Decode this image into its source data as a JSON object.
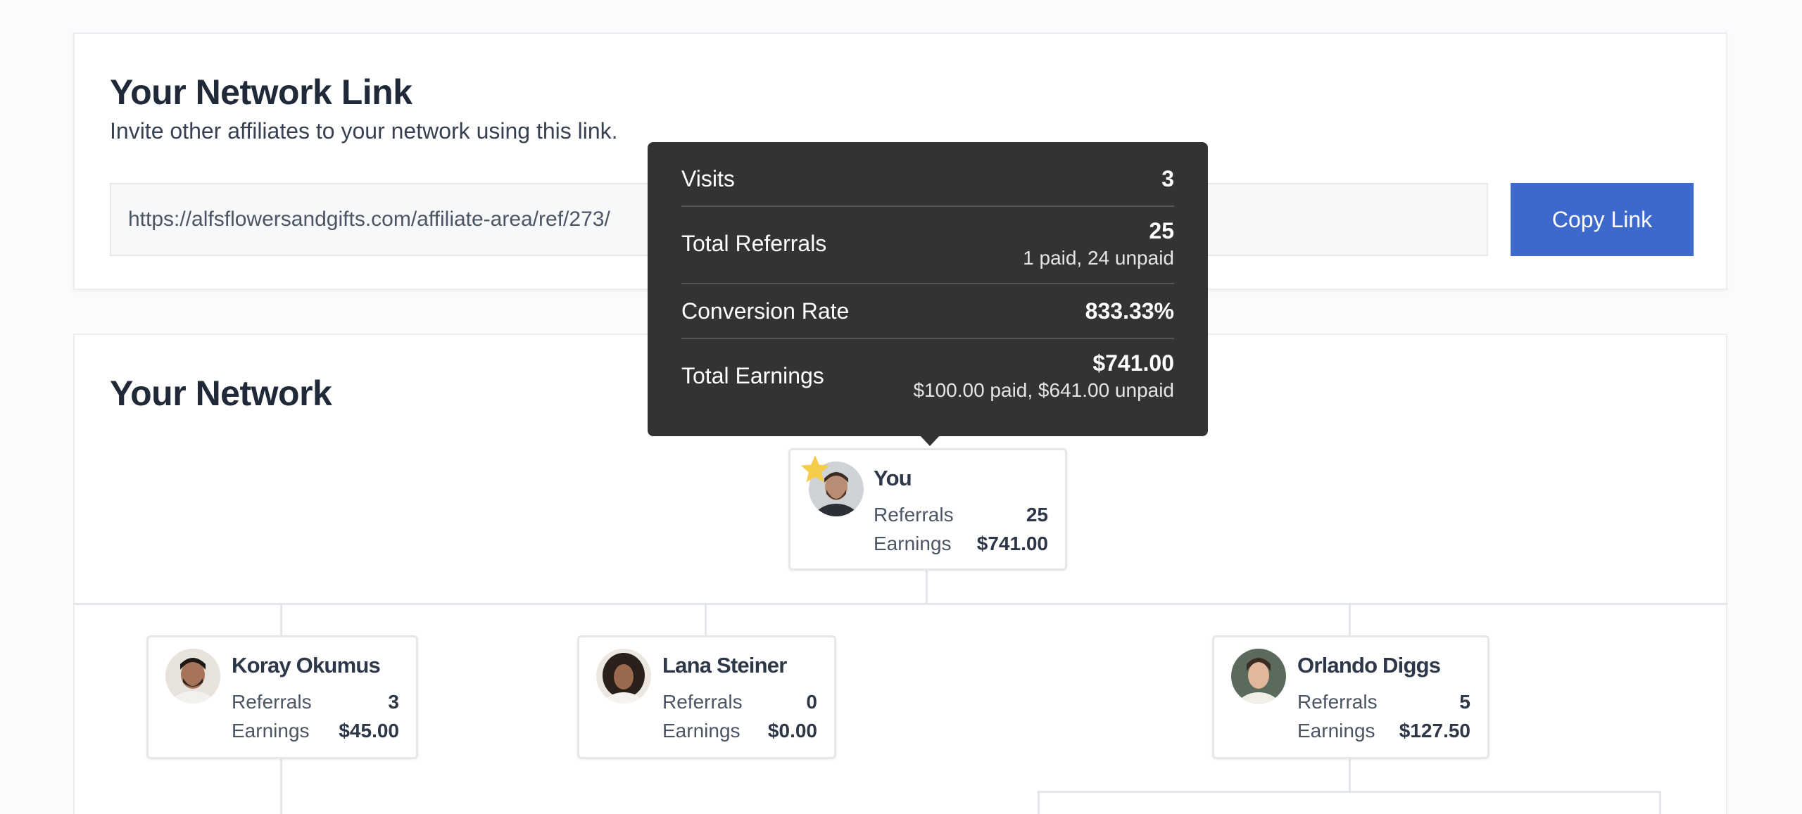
{
  "network_link": {
    "title": "Your Network Link",
    "description": "Invite other affiliates to your network using this link.",
    "url": "https://alfsflowersandgifts.com/affiliate-area/ref/273/",
    "copy_label": "Copy Link"
  },
  "network": {
    "title": "Your Network",
    "root": {
      "name": "You",
      "referrals_label": "Referrals",
      "referrals": "25",
      "earnings_label": "Earnings",
      "earnings": "$741.00"
    },
    "children": [
      {
        "name": "Koray Okumus",
        "referrals_label": "Referrals",
        "referrals": "3",
        "earnings_label": "Earnings",
        "earnings": "$45.00"
      },
      {
        "name": "Lana Steiner",
        "referrals_label": "Referrals",
        "referrals": "0",
        "earnings_label": "Earnings",
        "earnings": "$0.00"
      },
      {
        "name": "Orlando Diggs",
        "referrals_label": "Referrals",
        "referrals": "5",
        "earnings_label": "Earnings",
        "earnings": "$127.50"
      }
    ]
  },
  "tooltip": {
    "visits_label": "Visits",
    "visits": "3",
    "referrals_label": "Total Referrals",
    "referrals": "25",
    "referrals_detail": "1 paid, 24 unpaid",
    "conversion_label": "Conversion Rate",
    "conversion": "833.33%",
    "earnings_label": "Total Earnings",
    "earnings": "$741.00",
    "earnings_detail": "$100.00 paid, $641.00 unpaid"
  },
  "icons": {
    "star": "star-icon",
    "avatar": "avatar"
  },
  "colors": {
    "primary": "#3d68cc",
    "tooltip_bg": "#333333",
    "star": "#f4cd4b"
  }
}
